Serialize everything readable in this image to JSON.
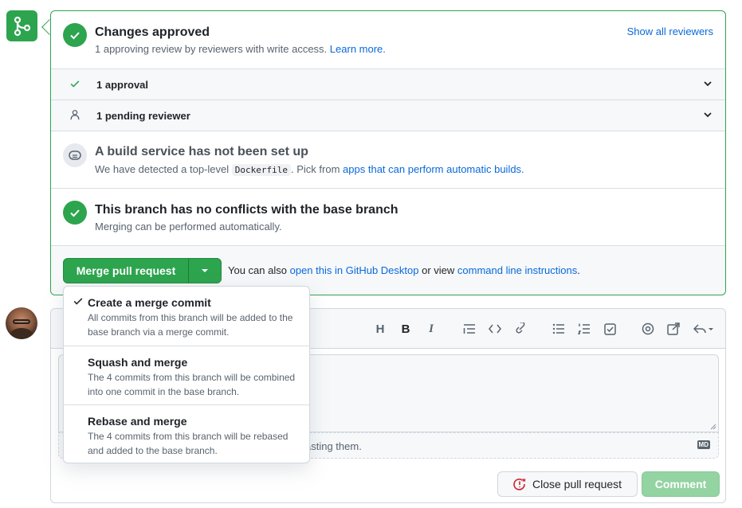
{
  "merge_box": {
    "approved": {
      "title": "Changes approved",
      "subtitle": "1 approving review by reviewers with write access.",
      "learn_more": "Learn more.",
      "show_all": "Show all reviewers"
    },
    "approvals_row": "1 approval",
    "pending_row": "1 pending reviewer",
    "build": {
      "title": "A build service has not been set up",
      "sub_prefix": "We have detected a top-level",
      "code": "Dockerfile",
      "sub_middle": ". Pick from",
      "link": "apps that can perform automatic builds."
    },
    "conflicts": {
      "title": "This branch has no conflicts with the base branch",
      "subtitle": "Merging can be performed automatically."
    },
    "merge_button": "Merge pull request",
    "also_prefix": "You can also",
    "desktop_link": "open this in GitHub Desktop",
    "also_middle": "or view",
    "cli_link": "command line instructions",
    "also_suffix": "."
  },
  "merge_menu": [
    {
      "title": "Create a merge commit",
      "desc": "All commits from this branch will be added to the base branch via a merge commit.",
      "selected": true
    },
    {
      "title": "Squash and merge",
      "desc": "The 4 commits from this branch will be combined into one commit in the base branch.",
      "selected": false
    },
    {
      "title": "Rebase and merge",
      "desc": "The 4 commits from this branch will be rebased and added to the base branch.",
      "selected": false
    }
  ],
  "comment": {
    "attach_hint_visible": "asting them.",
    "close_button": "Close pull request",
    "comment_button": "Comment",
    "markdown_badge": "MD"
  },
  "toolbar_icons": [
    "heading-icon",
    "bold-icon",
    "italic-icon",
    "quote-icon",
    "code-icon",
    "link-icon",
    "unordered-list-icon",
    "ordered-list-icon",
    "task-list-icon",
    "mention-icon",
    "reference-icon",
    "reply-icon"
  ],
  "colors": {
    "green": "#2da44e",
    "link": "#0969da",
    "comment_disabled": "#94d3a2",
    "close_red": "#cf222e"
  }
}
